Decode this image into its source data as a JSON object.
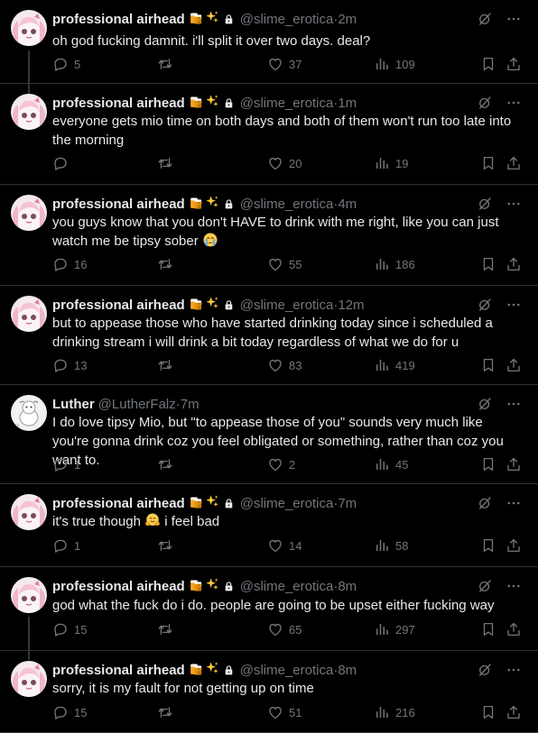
{
  "tweets": [
    {
      "name": "professional airhead",
      "handle": "@slime_erotica",
      "time": "2m",
      "text_before": "oh god fucking damnit. i'll split it over two days. deal?",
      "text_after": "",
      "replies": "5",
      "reposts": "",
      "likes": "37",
      "views": "109"
    },
    {
      "name": "professional airhead",
      "handle": "@slime_erotica",
      "time": "1m",
      "text_before": "everyone gets mio time on both days and both of them won't run too late into the morning",
      "text_after": "",
      "replies": "",
      "reposts": "",
      "likes": "20",
      "views": "19"
    },
    {
      "name": "professional airhead",
      "handle": "@slime_erotica",
      "time": "4m",
      "text_before": "you guys know that you don't HAVE to drink with me right, like you can just watch me be tipsy sober ",
      "text_after": "",
      "replies": "16",
      "reposts": "",
      "likes": "55",
      "views": "186"
    },
    {
      "name": "professional airhead",
      "handle": "@slime_erotica",
      "time": "12m",
      "text_before": "but to appease those who have started drinking today since i scheduled a drinking stream i will drink a bit today regardless of what we do for u",
      "text_after": "",
      "replies": "13",
      "reposts": "",
      "likes": "83",
      "views": "419"
    },
    {
      "name": "Luther",
      "handle": "@LutherFalz",
      "time": "7m",
      "text_before": "I do love tipsy Mio, but \"to appease those of you\" sounds very much like you're gonna drink coz you feel obligated or something, rather than coz you want to.",
      "text_after": "",
      "replies": "1",
      "reposts": "",
      "likes": "2",
      "views": "45"
    },
    {
      "name": "professional airhead",
      "handle": "@slime_erotica",
      "time": "7m",
      "text_before": "it's true though ",
      "text_after": " i feel bad",
      "replies": "1",
      "reposts": "",
      "likes": "14",
      "views": "58"
    },
    {
      "name": "professional airhead",
      "handle": "@slime_erotica",
      "time": "8m",
      "text_before": "god what the fuck do i do. people are going to be upset either fucking way",
      "text_after": "",
      "replies": "15",
      "reposts": "",
      "likes": "65",
      "views": "297"
    },
    {
      "name": "professional airhead",
      "handle": "@slime_erotica",
      "time": "8m",
      "text_before": "sorry, it is my fault for not getting up on time",
      "text_after": "",
      "replies": "15",
      "reposts": "",
      "likes": "51",
      "views": "216"
    }
  ],
  "separator": " · ",
  "colors": {
    "background": "#000000",
    "text": "#e7e9ea",
    "muted": "#71767b",
    "border": "#2f3336",
    "thread": "#333639"
  },
  "icons": [
    "reply-icon",
    "repost-icon",
    "like-icon",
    "views-icon",
    "bookmark-icon",
    "share-icon",
    "grok-icon",
    "more-icon",
    "lock-icon",
    "beer-emoji",
    "sparkles-emoji",
    "crying-emoji",
    "hugging-emoji"
  ]
}
